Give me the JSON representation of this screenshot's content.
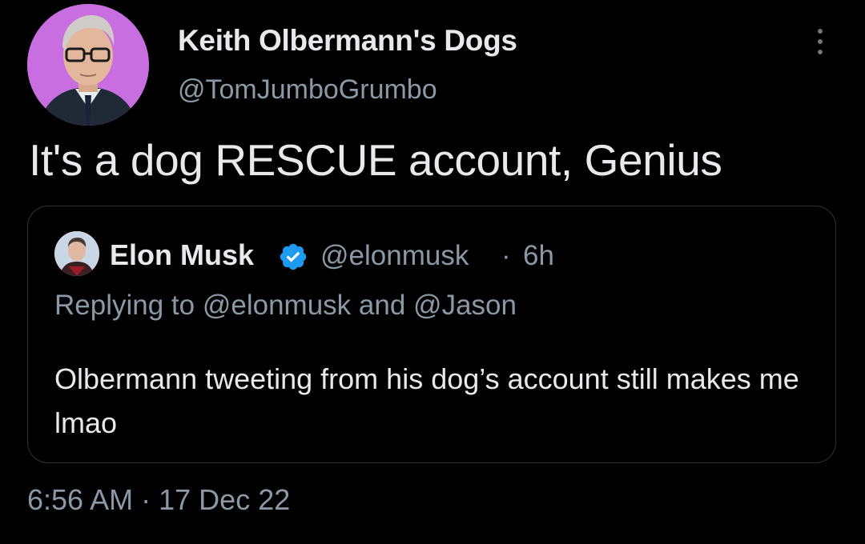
{
  "author": {
    "display_name": "Keith Olbermann's Dogs",
    "handle": "@TomJumboGrumbo",
    "avatar_bg": "#c86ee0"
  },
  "tweet": {
    "text": "It's a dog RESCUE account, Genius"
  },
  "quoted": {
    "display_name": "Elon Musk",
    "handle": "@elonmusk",
    "separator": "·",
    "age": "6h",
    "replying_prefix": "Replying to",
    "replying_user_1": "@elonmusk",
    "replying_joiner": "and",
    "replying_user_2": "@Jason",
    "text": "Olbermann tweeting from his dog’s account still makes me lmao",
    "verified_color": "#1d9bf0"
  },
  "meta": {
    "time": "6:56 AM",
    "separator": "·",
    "date": "17 Dec 22"
  },
  "icons": {
    "more": "more-vertical-icon",
    "verified": "verified-badge-icon"
  }
}
